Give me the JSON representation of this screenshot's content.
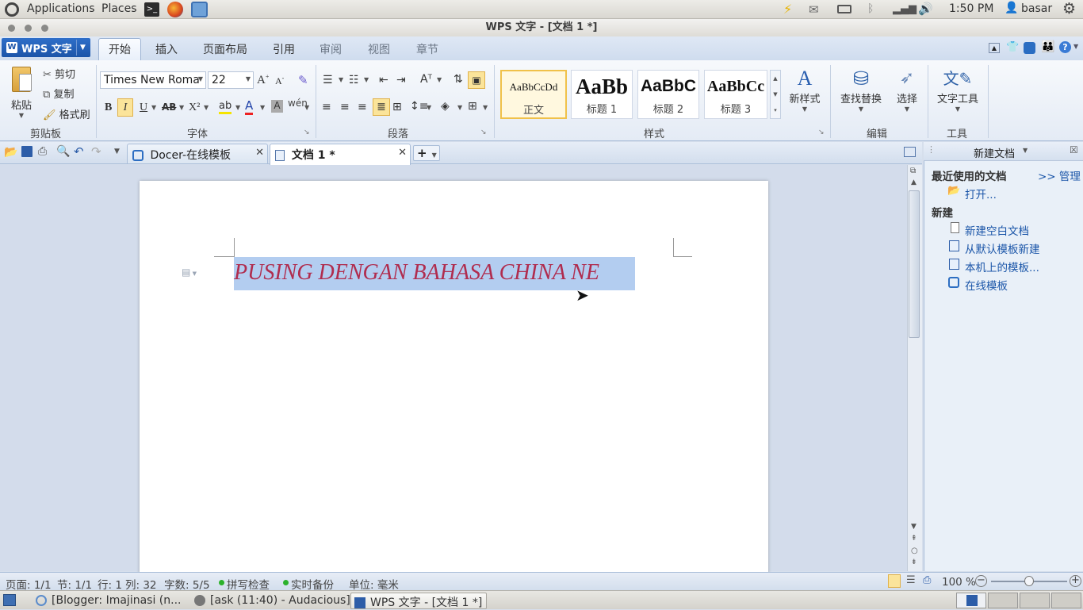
{
  "top_panel": {
    "applications": "Applications",
    "places": "Places",
    "time": "1:50 PM",
    "user": "basar"
  },
  "window": {
    "title": "WPS 文字 - [文档 1 *]"
  },
  "menu": {
    "app_button": "WPS 文字",
    "tabs": [
      "开始",
      "插入",
      "页面布局",
      "引用",
      "审阅",
      "视图",
      "章节"
    ]
  },
  "ribbon": {
    "clipboard": {
      "paste": "粘贴",
      "cut": "剪切",
      "copy": "复制",
      "format_painter": "格式刷",
      "label": "剪贴板"
    },
    "font": {
      "name": "Times New Roma",
      "size": "22",
      "label": "字体",
      "bold": "B",
      "italic": "I",
      "underline": "U",
      "strike": "AB",
      "superscript": "X²"
    },
    "paragraph": {
      "label": "段落"
    },
    "styles": {
      "label": "样式",
      "items": [
        {
          "sample": "AaBbCcDd",
          "name": "正文"
        },
        {
          "sample": "AaBb",
          "name": "标题 1"
        },
        {
          "sample": "AaBbC",
          "name": "标题 2"
        },
        {
          "sample": "AaBbCc",
          "name": "标题 3"
        }
      ],
      "new_style": "新样式"
    },
    "edit": {
      "find_replace": "查找替换",
      "select": "选择",
      "label": "编辑"
    },
    "tools": {
      "text_tools": "文字工具",
      "label": "工具"
    }
  },
  "tabs": {
    "docer": "Docer-在线模板",
    "doc": "文档 1 *"
  },
  "document": {
    "text": "PUSING DENGAN BAHASA CHINA NE"
  },
  "side_pane": {
    "title": "新建文档",
    "recent": "最近使用的文档",
    "manage": ">> 管理",
    "open": "打开...",
    "new_heading": "新建",
    "new_blank": "新建空白文档",
    "from_default": "从默认模板新建",
    "local_templates": "本机上的模板...",
    "online_templates": "在线模板"
  },
  "status": {
    "page": "页面: 1/1",
    "section": "节: 1/1",
    "line": "行: 1",
    "column": "列: 32",
    "words": "字数: 5/5",
    "spellcheck": "拼写检查",
    "backup": "实时备份",
    "unit": "单位: 毫米",
    "zoom": "100 %",
    "zoom_level": 0.5
  },
  "taskbar": {
    "items": [
      "[Blogger: Imajinasi (n...",
      "[ask (11:40) - Audacious]",
      "WPS 文字 - [文档 1 *]"
    ]
  },
  "colors": {
    "accent": "#1b54a8",
    "selection": "#b3cdf0",
    "doc_text": "#b02c4e"
  }
}
